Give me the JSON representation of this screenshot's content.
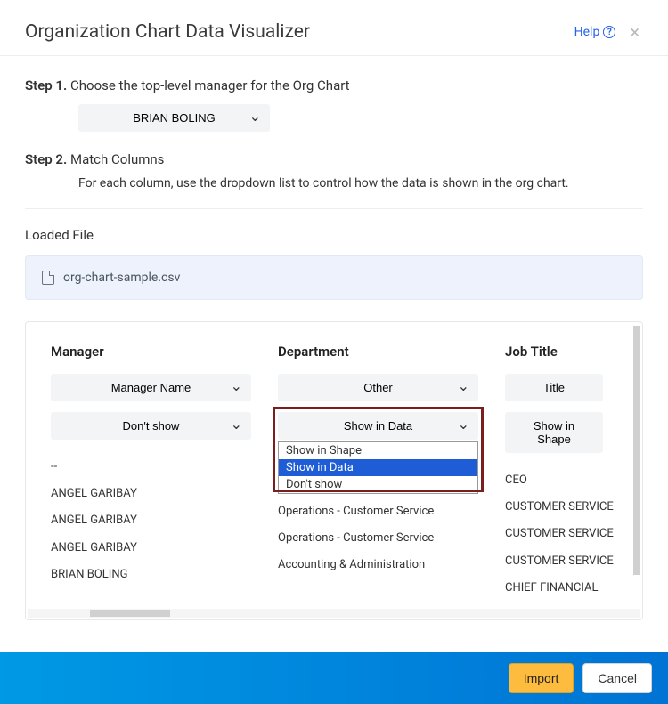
{
  "header": {
    "title": "Organization Chart Data Visualizer",
    "help": "Help"
  },
  "step1": {
    "label": "Step 1.",
    "text": "Choose the top-level manager for the Org Chart",
    "selected": "BRIAN BOLING"
  },
  "step2": {
    "label": "Step 2.",
    "text": "Match Columns",
    "sub": "For each column, use the dropdown list to control how the data is shown in the org chart."
  },
  "loaded": {
    "label": "Loaded File",
    "filename": "org-chart-sample.csv"
  },
  "columns": [
    {
      "name": "Manager",
      "typeSelect": "Manager Name",
      "showSelect": "Don't show",
      "values": [
        "--",
        "ANGEL GARIBAY",
        "ANGEL GARIBAY",
        "ANGEL GARIBAY",
        "BRIAN BOLING"
      ]
    },
    {
      "name": "Department",
      "typeSelect": "Other",
      "showSelect": "Show in Data",
      "dropdownOptions": [
        "Show in Shape",
        "Show in Data",
        "Don't show"
      ],
      "dropdownSelected": "Show in Data",
      "values": [
        "",
        "Operations - Customer Service",
        "Operations - Customer Service",
        "Accounting & Administration"
      ]
    },
    {
      "name": "Job Title",
      "typeSelect": "Title",
      "showSelect": "Show in Shape",
      "values": [
        "CEO",
        "CUSTOMER SERVICE",
        "CUSTOMER SERVICE",
        "CUSTOMER SERVICE",
        "CHIEF FINANCIAL"
      ]
    }
  ],
  "footer": {
    "import": "Import",
    "cancel": "Cancel"
  }
}
